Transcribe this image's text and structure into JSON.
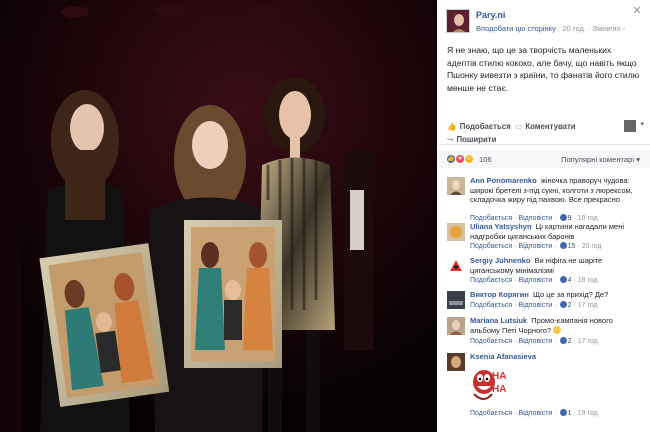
{
  "post": {
    "page_name": "Pary.ni",
    "embed_label": "Вподобати цю сторінку",
    "time": "20 год.",
    "edited": "Змінено",
    "text": "Я не знаю, що це за творчість маленьких адептів стилю кококо, але бачу, що навіть якщо Пшонку вивезти з країни, то фанатів його стилю менше не стає.",
    "sep": "·"
  },
  "actions": {
    "like": "Подобається",
    "comment": "Коментувати",
    "share": "Поширити"
  },
  "reactions": {
    "count": "106",
    "sort_label": "Популярні коментарі"
  },
  "comments": [
    {
      "author": "Ann Ponomarenko",
      "text": "жіночка праворуч чудова: широкі бретелі з-під сукні, колготи з люрексом, складочка жиру під пахвою. Все прекрасно",
      "like": "Подобається",
      "reply": "Відповісти",
      "likes": "9",
      "time": "19 год"
    },
    {
      "author": "Uliana Yatsyshyn",
      "text": "Ці картини нагадали мені надгробки циганських баронів",
      "like": "Подобається",
      "reply": "Відповісти",
      "likes": "15",
      "time": "20 год"
    },
    {
      "author": "Sergiy Juhnenko",
      "text": "Ви нiфiга не шарiте циганському мiнiмалiзмi",
      "like": "Подобається",
      "reply": "Відповісти",
      "likes": "4",
      "time": "18 год"
    },
    {
      "author": "Виктор Корягин",
      "text": "Що це за прихід? Де?",
      "like": "Подобається",
      "reply": "Відповісти",
      "likes": "2",
      "time": "17 год"
    },
    {
      "author": "Mariana Lutsiuk",
      "text": "Промо-кампанія нового альбому Петі Чорного?",
      "like": "Подобається",
      "reply": "Відповісти",
      "likes": "2",
      "time": "17 год"
    },
    {
      "author": "Ksenia Afanasieva",
      "text": "",
      "sticker_text": "HA HA",
      "like": "Подобається",
      "reply": "Відповісти",
      "likes": "1",
      "time": "19 год"
    }
  ],
  "icons": {
    "close": "close-icon",
    "like": "thumbs-up-icon",
    "comment": "speech-bubble-icon",
    "share": "share-arrow-icon",
    "caret": "caret-down-icon"
  },
  "colors": {
    "link": "#365899",
    "like_blue": "#4267b2",
    "love_red": "#ed4c5c",
    "haha_yellow": "#f7b125"
  }
}
